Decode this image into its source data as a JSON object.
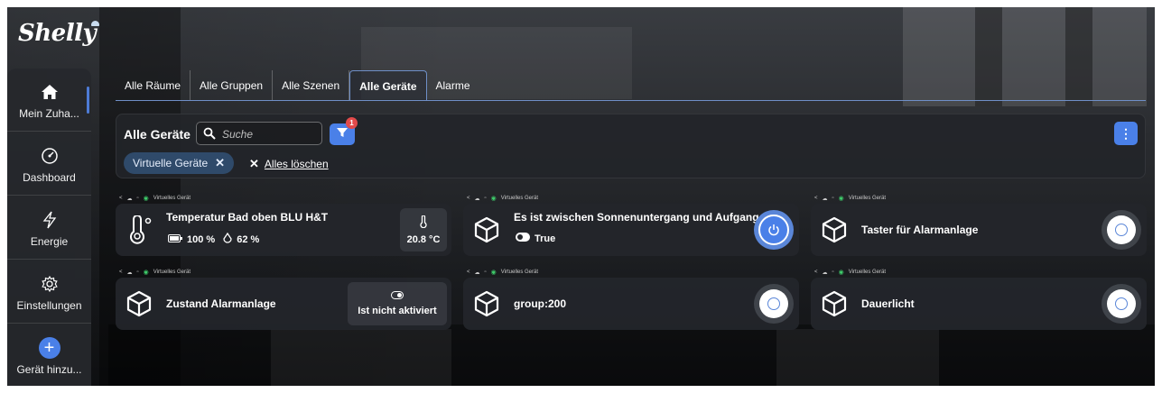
{
  "app": {
    "logo": "Shelly"
  },
  "sidebar": {
    "items": [
      {
        "label": "Mein Zuha...",
        "icon": "home-icon"
      },
      {
        "label": "Dashboard",
        "icon": "gauge-icon"
      },
      {
        "label": "Energie",
        "icon": "lightning-icon"
      },
      {
        "label": "Einstellungen",
        "icon": "gear-icon"
      },
      {
        "label": "Gerät hinzu...",
        "icon": "plus-icon"
      }
    ]
  },
  "tabs": [
    {
      "label": "Alle Räume"
    },
    {
      "label": "Alle Gruppen"
    },
    {
      "label": "Alle Szenen"
    },
    {
      "label": "Alle Geräte",
      "active": true
    },
    {
      "label": "Alarme"
    }
  ],
  "filter": {
    "title": "Alle Geräte",
    "search_placeholder": "Suche",
    "badge_count": "1",
    "more": "⋮",
    "chip_label": "Virtuelle Geräte",
    "clear_all": "Alles löschen"
  },
  "meta_label": "Virtuelles Gerät",
  "devices": [
    {
      "name": "Temperatur Bad oben BLU H&T",
      "battery": "100 %",
      "humidity": "62 %",
      "temperature": "20.8 °C"
    },
    {
      "name": "Es ist zwischen Sonnenuntergang und Aufgang",
      "state": "True",
      "power": "on"
    },
    {
      "name": "Taster für Alarmanlage",
      "power": "off"
    },
    {
      "name": "Zustand Alarmanlage",
      "state_text": "Ist nicht aktiviert"
    },
    {
      "name": "group:200",
      "power": "off"
    },
    {
      "name": "Dauerlicht",
      "power": "off"
    }
  ],
  "colors": {
    "accent": "#4a80e8",
    "badge": "#e24a4a",
    "chip": "#2f4a6a",
    "online": "#3ecb6a"
  }
}
